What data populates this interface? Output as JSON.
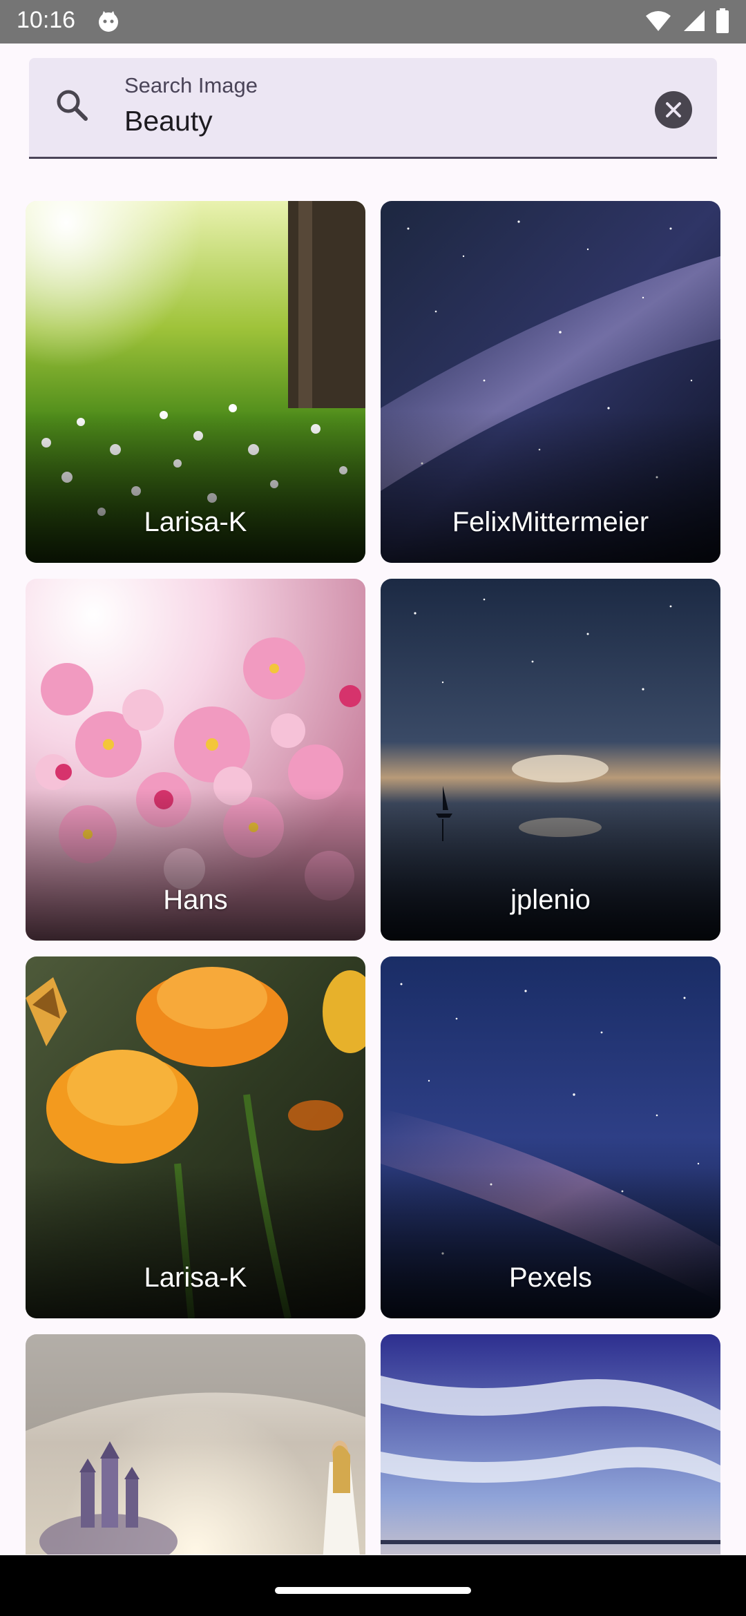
{
  "status_bar": {
    "time": "10:16",
    "icons": [
      "cat-notification-icon",
      "wifi-icon",
      "cellular-signal-icon",
      "battery-icon"
    ]
  },
  "search": {
    "label": "Search Image",
    "value": "Beauty",
    "icon": "search-icon",
    "clear_icon": "clear-icon"
  },
  "results": [
    {
      "author": "Larisa-K",
      "theme": "spring-meadow"
    },
    {
      "author": "FelixMittermeier",
      "theme": "milky-way"
    },
    {
      "author": "Hans",
      "theme": "pink-blossoms"
    },
    {
      "author": "jplenio",
      "theme": "night-sea-sailboat"
    },
    {
      "author": "Larisa-K",
      "theme": "orange-flowers-butterfly"
    },
    {
      "author": "Pexels",
      "theme": "starry-sky"
    },
    {
      "author": "",
      "theme": "fantasy-castle-woman"
    },
    {
      "author": "",
      "theme": "sunset-ocean-clouds"
    }
  ],
  "colors": {
    "status_bar": "#757575",
    "search_bg": "#ece6f3",
    "page_bg": "#fdf8fd"
  }
}
